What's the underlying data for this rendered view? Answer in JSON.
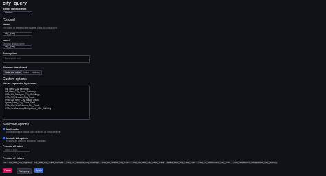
{
  "page": {
    "title": "city_query"
  },
  "type_select": {
    "label": "Select variable type",
    "value": "Custom"
  },
  "general": {
    "heading": "General",
    "name_label": "Name",
    "name_hint": "The name of the template variable. (Max. 50 characters)",
    "name_value": "city_query",
    "label_label": "Label",
    "label_hint": "Optional display name",
    "label_value": "city_query",
    "description_label": "Description",
    "description_placeholder": "Descriptive text"
  },
  "show_on_dashboard": {
    "label": "Show on dashboard",
    "options": [
      "Label and value",
      "Value",
      "Nothing"
    ],
    "selected": "Label and value"
  },
  "custom_options": {
    "heading": "Custom options",
    "values_label": "Values separated by comma",
    "values": [
      "Intl_New_City_Highway,",
      "Intl_New_City_Track_Pathway,",
      "USA_NY_Newyork_City_Buildings,",
      "USA_NJ_Newark_City_Track,",
      "USA_CA_New_City_Napa_Track,",
      "Space_New_City_Track_Field,",
      "USA_LA_NewOrleans_City_Track,",
      "USA_NewMexico_Albuquerque_City_Building"
    ]
  },
  "selection_options": {
    "heading": "Selection options",
    "multi_value_label": "Multi-value",
    "multi_value_hint": "Enables multiple values to be selected at the same time",
    "include_all_label": "Include All option",
    "include_all_hint": "Enables an option to include all variables",
    "custom_all_label": "Custom all value",
    "custom_all_placeholder": "blank = auto",
    "checkbox_color": "#3d71d9"
  },
  "preview": {
    "label": "Preview of values",
    "chips": [
      "All",
      "Intl_New_City_Highway",
      "Intl_New_City_Track_Pathway",
      "USA_NY_Newyork_City_Buildings",
      "USA_NJ_Newark_City_Track",
      "USA_CA_New_City_Napa_Track",
      "Space_New_City_Track_Field",
      "USA_LA_NewOrleans_City_Track",
      "USA_NewMexico_Albuquerque_City_Building"
    ]
  },
  "footer": {
    "delete_label": "Delete",
    "run_query_label": "Run query",
    "apply_label": "Apply",
    "delete_color": "#d10e5c",
    "apply_color": "#3d71d9"
  }
}
